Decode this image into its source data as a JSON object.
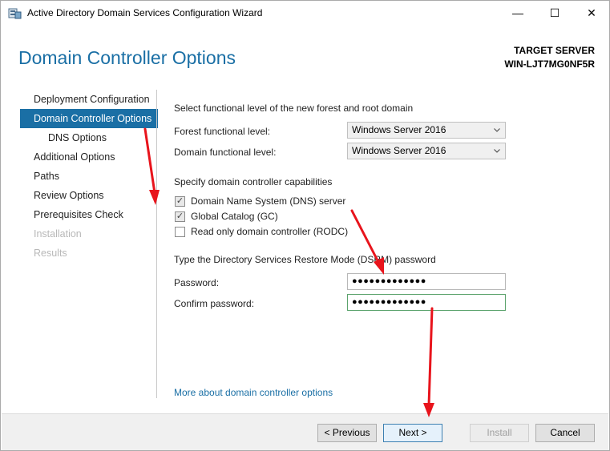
{
  "window": {
    "title": "Active Directory Domain Services Configuration Wizard",
    "min_glyph": "—",
    "max_glyph": "☐",
    "close_glyph": "✕"
  },
  "header": {
    "title": "Domain Controller Options",
    "target_label": "TARGET SERVER",
    "target_name": "WIN-LJT7MG0NF5R"
  },
  "nav": {
    "items": [
      {
        "label": "Deployment Configuration",
        "state": "normal"
      },
      {
        "label": "Domain Controller Options",
        "state": "active"
      },
      {
        "label": "DNS Options",
        "state": "sub"
      },
      {
        "label": "Additional Options",
        "state": "normal"
      },
      {
        "label": "Paths",
        "state": "normal"
      },
      {
        "label": "Review Options",
        "state": "normal"
      },
      {
        "label": "Prerequisites Check",
        "state": "normal"
      },
      {
        "label": "Installation",
        "state": "disabled"
      },
      {
        "label": "Results",
        "state": "disabled"
      }
    ]
  },
  "functional": {
    "heading": "Select functional level of the new forest and root domain",
    "forest_label": "Forest functional level:",
    "forest_value": "Windows Server 2016",
    "domain_label": "Domain functional level:",
    "domain_value": "Windows Server 2016"
  },
  "capabilities": {
    "heading": "Specify domain controller capabilities",
    "dns_label": "Domain Name System (DNS) server",
    "gc_label": "Global Catalog (GC)",
    "rodc_label": "Read only domain controller (RODC)",
    "check_glyph": "✓"
  },
  "dsrm": {
    "heading": "Type the Directory Services Restore Mode (DSRM) password",
    "password_label": "Password:",
    "password_value": "●●●●●●●●●●●●●",
    "confirm_label": "Confirm password:",
    "confirm_value": "●●●●●●●●●●●●●"
  },
  "link": {
    "more": "More about domain controller options"
  },
  "footer": {
    "previous": "< Previous",
    "next": "Next >",
    "install": "Install",
    "cancel": "Cancel"
  },
  "colors": {
    "accent": "#1a6fa5",
    "arrow": "#e8141c"
  },
  "icons": {
    "app": "server-wizard-icon",
    "chevron": "chevron-down-icon"
  }
}
